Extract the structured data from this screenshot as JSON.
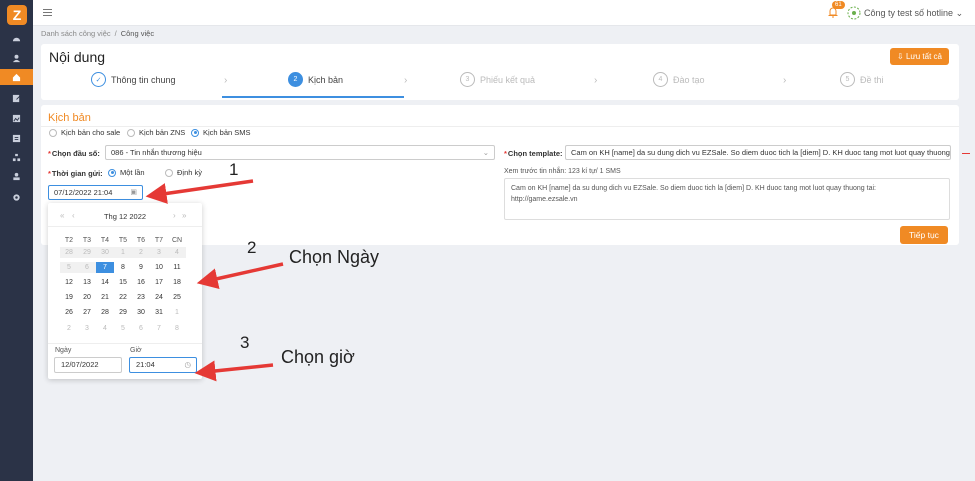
{
  "sidebar": {
    "logo": "Z",
    "items": [
      "dashboard-icon",
      "user-icon",
      "home-icon",
      "edit-icon",
      "image-icon",
      "list-icon",
      "sitemap-icon",
      "users-icon",
      "gear-icon"
    ]
  },
  "topbar": {
    "notification_count": "61",
    "company_name": "Công ty test số hotline"
  },
  "breadcrumb": {
    "items": [
      "Danh sách công việc",
      "Công việc"
    ]
  },
  "header": {
    "title": "Nội dung",
    "save_all": "Lưu tất cả",
    "steps": [
      {
        "num": "✓",
        "label": "Thông tin chung"
      },
      {
        "num": "2",
        "label": "Kịch bản"
      },
      {
        "num": "3",
        "label": "Phiếu kết quả"
      },
      {
        "num": "4",
        "label": "Đào tạo"
      },
      {
        "num": "5",
        "label": "Đề thi"
      }
    ]
  },
  "form": {
    "section_title": "Kịch bản",
    "script_types": [
      "Kịch bản cho sale",
      "Kịch bản ZNS",
      "Kịch bản SMS"
    ],
    "selected_script_type": "Kịch bản SMS",
    "number_label": "Chọn đầu số:",
    "number_value": "086 - Tin nhắn thương hiệu",
    "template_label": "Chọn template:",
    "template_value": "Cam on KH [name] da su dung dich vu EZSale. So diem duoc tich la [diem] D. KH duoc tang mot luot quay thuong tai:",
    "send_time_label": "Thời gian gửi:",
    "send_time_options": [
      "Một lần",
      "Định kỳ"
    ],
    "send_time_selected": "Một lần",
    "datetime_value": "07/12/2022 21:04",
    "preview_label": "Xem trước tin nhắn: 123 kí tự/ 1 SMS",
    "preview_text_1": "Cam on KH [name] da su dung dich vu EZSale. So diem duoc tich la [diem] D. KH duoc tang mot luot quay thuong tai:",
    "preview_text_2": "http://game.ezsale.vn",
    "continue": "Tiếp tục"
  },
  "calendar": {
    "month_label": "Thg 12  2022",
    "nav": {
      "prev_year": "«",
      "prev_month": "‹",
      "next_month": "›",
      "next_year": "»"
    },
    "weekdays": [
      "T2",
      "T3",
      "T4",
      "T5",
      "T6",
      "T7",
      "CN"
    ],
    "weeks": [
      [
        "28",
        "29",
        "30",
        "1",
        "2",
        "3",
        "4"
      ],
      [
        "5",
        "6",
        "7",
        "8",
        "9",
        "10",
        "11"
      ],
      [
        "12",
        "13",
        "14",
        "15",
        "16",
        "17",
        "18"
      ],
      [
        "19",
        "20",
        "21",
        "22",
        "23",
        "24",
        "25"
      ],
      [
        "26",
        "27",
        "28",
        "29",
        "30",
        "31",
        "1"
      ],
      [
        "2",
        "3",
        "4",
        "5",
        "6",
        "7",
        "8"
      ]
    ],
    "selected_day": "7",
    "date_label": "Ngày",
    "date_value": "12/07/2022",
    "time_label": "Giờ",
    "time_value": "21:04"
  },
  "annotations": {
    "step1": "1",
    "step2": "2",
    "step2_text": "Chọn Ngày",
    "step3": "3",
    "step3_text": "Chọn giờ"
  },
  "colors": {
    "accent": "#f08a24",
    "primary": "#3d8fe0",
    "sidebar": "#2b3347",
    "arrow": "#e53935"
  }
}
